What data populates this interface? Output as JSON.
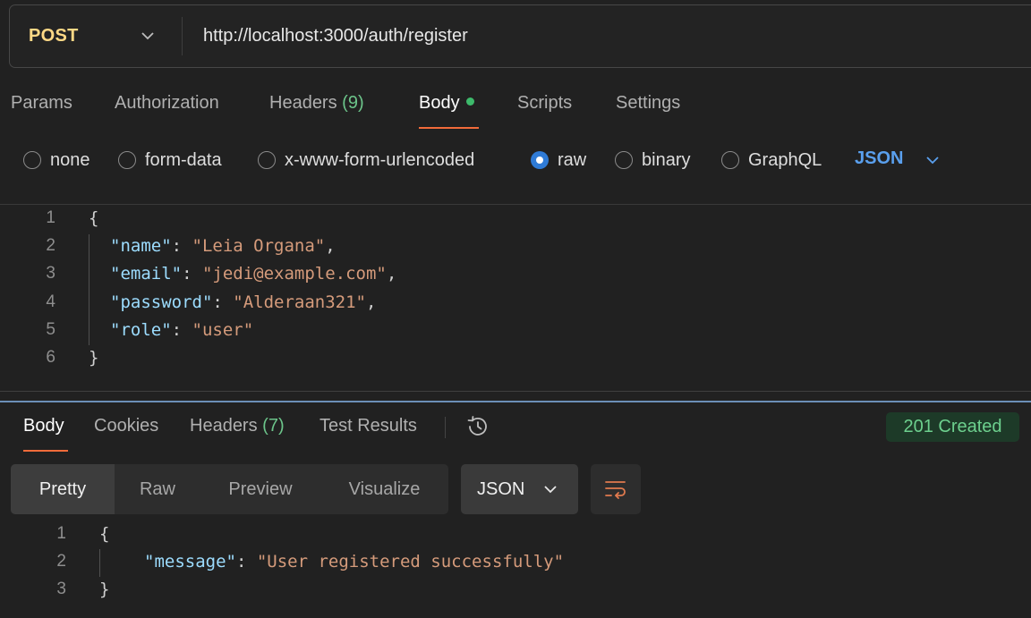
{
  "request": {
    "method": "POST",
    "url": "http://localhost:3000/auth/register"
  },
  "request_tabs": {
    "params": "Params",
    "authorization": "Authorization",
    "headers": "Headers",
    "headers_count": "(9)",
    "body": "Body",
    "scripts": "Scripts",
    "settings": "Settings"
  },
  "body_types": {
    "none": "none",
    "form_data": "form-data",
    "urlencoded": "x-www-form-urlencoded",
    "raw": "raw",
    "binary": "binary",
    "graphql": "GraphQL",
    "selected": "raw",
    "language": "JSON"
  },
  "request_body": {
    "line_numbers": [
      "1",
      "2",
      "3",
      "4",
      "5",
      "6"
    ],
    "open_brace": "{",
    "close_brace": "}",
    "fields": [
      {
        "key": "\"name\"",
        "value": "\"Leia Organa\"",
        "trail": ","
      },
      {
        "key": "\"email\"",
        "value": "\"jedi@example.com\"",
        "trail": ","
      },
      {
        "key": "\"password\"",
        "value": "\"Alderaan321\"",
        "trail": ","
      },
      {
        "key": "\"role\"",
        "value": "\"user\"",
        "trail": ""
      }
    ]
  },
  "response_tabs": {
    "body": "Body",
    "cookies": "Cookies",
    "headers": "Headers",
    "headers_count": "(7)",
    "test_results": "Test Results"
  },
  "status": "201 Created",
  "view_modes": {
    "pretty": "Pretty",
    "raw": "Raw",
    "preview": "Preview",
    "visualize": "Visualize",
    "selected": "Pretty"
  },
  "response_format": "JSON",
  "response_body": {
    "line_numbers": [
      "1",
      "2",
      "3"
    ],
    "open_brace": "{",
    "close_brace": "}",
    "key": "\"message\"",
    "value": "\"User registered successfully\""
  },
  "colors": {
    "accent_orange": "#f26b3a",
    "method_yellow": "#ffd986",
    "json_blue": "#5aa0ee",
    "status_green": "#6dd08e"
  },
  "icons": {
    "method_dropdown": "chevron-down-icon",
    "language_dropdown": "chevron-down-icon",
    "history": "history-icon",
    "wrap": "wrap-lines-icon"
  }
}
